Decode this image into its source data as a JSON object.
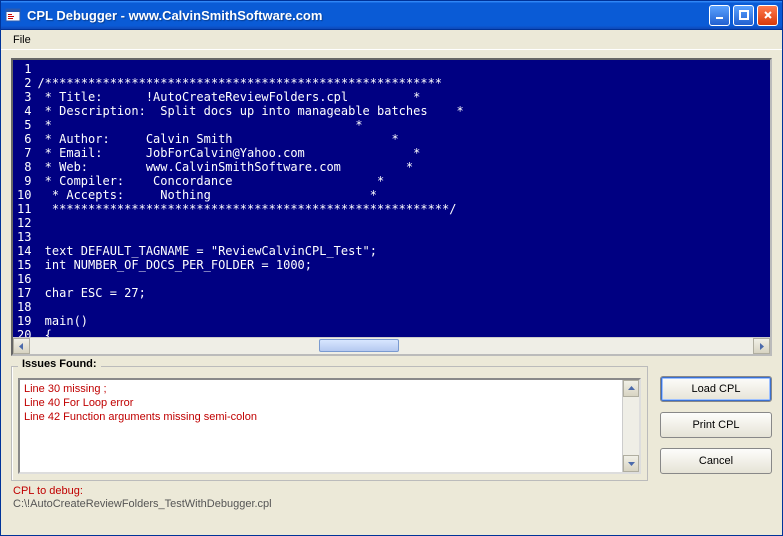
{
  "window": {
    "title": "CPL Debugger - www.CalvinSmithSoftware.com"
  },
  "menu": {
    "file": "File"
  },
  "code": {
    "lines": [
      "",
      "/*******************************************************",
      " * Title:      !AutoCreateReviewFolders.cpl         *",
      " * Description:  Split docs up into manageable batches    *",
      " *                                          *",
      " * Author:     Calvin Smith                      *",
      " * Email:      JobForCalvin@Yahoo.com               *",
      " * Web:        www.CalvinSmithSoftware.com         *",
      " * Compiler:    Concordance                    *",
      "  * Accepts:     Nothing                      *",
      "  *******************************************************/",
      "",
      "",
      " text DEFAULT_TAGNAME = \"ReviewCalvinCPL_Test\";",
      " int NUMBER_OF_DOCS_PER_FOLDER = 1000;",
      "",
      " char ESC = 27;",
      "",
      " main()",
      " {"
    ]
  },
  "issues": {
    "legend": "Issues Found:",
    "items": [
      "Line 30 missing ;",
      "Line 40 For Loop error",
      "Line 42 Function arguments missing semi-colon"
    ]
  },
  "buttons": {
    "load": "Load CPL",
    "print": "Print CPL",
    "cancel": "Cancel"
  },
  "footer": {
    "label": "CPL to debug:",
    "path": "C:\\!AutoCreateReviewFolders_TestWithDebugger.cpl"
  }
}
